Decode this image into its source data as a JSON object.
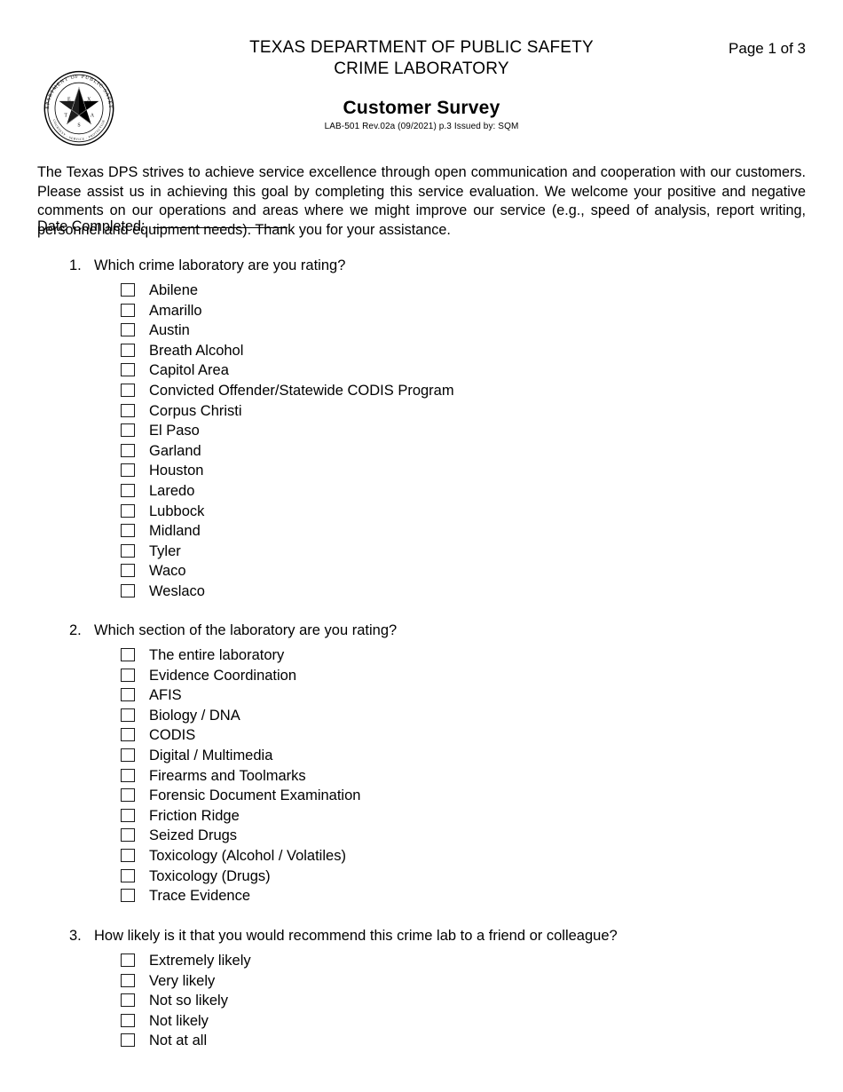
{
  "header": {
    "seal_icon": "texas-dps-seal",
    "seal_text": {
      "top_arc": "DEPARTMENT OF PUBLIC SAFETY",
      "bottom_arc": "COURTESY - SERVICE - PROTECTION",
      "star_letters": [
        "E",
        "X",
        "T",
        "A",
        "S"
      ]
    },
    "org_line_1": "TEXAS DEPARTMENT OF PUBLIC SAFETY",
    "org_line_2": "CRIME LABORATORY",
    "doc_title": "Customer Survey",
    "doc_revision": "LAB-501 Rev.02a (09/2021) p.3 Issued by: SQM",
    "page_number": "Page 1 of 3"
  },
  "intro": {
    "paragraph": "The Texas DPS strives to achieve service excellence through open communication and cooperation with our customers. Please assist us in achieving this goal by completing this service evaluation. We welcome your positive and negative comments on our operations and areas where we might improve our service (e.g., speed of analysis, report writing, personnel and equipment needs). Thank you for your assistance."
  },
  "date_completed": {
    "label": "Date Completed:",
    "value": ""
  },
  "questions": [
    {
      "number": "1.",
      "text": "Which crime laboratory are you rating?",
      "options": [
        "Abilene",
        "Amarillo",
        "Austin",
        "Breath Alcohol",
        "Capitol Area",
        "Convicted Offender/Statewide CODIS Program",
        "Corpus Christi",
        "El Paso",
        "Garland",
        "Houston",
        "Laredo",
        "Lubbock",
        "Midland",
        "Tyler",
        "Waco",
        "Weslaco"
      ]
    },
    {
      "number": "2.",
      "text": "Which section of the laboratory are you rating?",
      "options": [
        "The entire laboratory",
        "Evidence Coordination",
        "AFIS",
        "Biology / DNA",
        "CODIS",
        "Digital / Multimedia",
        "Firearms and Toolmarks",
        "Forensic Document Examination",
        "Friction Ridge",
        "Seized Drugs",
        "Toxicology (Alcohol / Volatiles)",
        "Toxicology (Drugs)",
        "Trace Evidence"
      ]
    },
    {
      "number": "3.",
      "text": "How likely is it that you would recommend this crime lab to a friend or colleague?",
      "options": [
        "Extremely likely",
        "Very likely",
        "Not so likely",
        "Not likely",
        "Not at all"
      ]
    }
  ],
  "colors": {
    "page_background": "#ffffff",
    "text": "#000000",
    "checkbox_border": "#1a1a1a"
  }
}
